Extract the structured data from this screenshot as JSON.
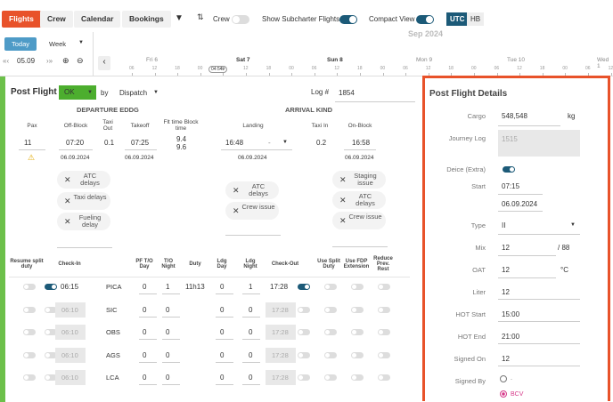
{
  "nav": {
    "tabs": [
      "Flights",
      "Crew",
      "Calendar",
      "Bookings"
    ],
    "crew_label": "Crew",
    "subcharter_label": "Show Subcharter Flights",
    "compact_label": "Compact View",
    "utc": "UTC",
    "hb": "HB"
  },
  "timeline": {
    "month": "Sep 2024",
    "today": "Today",
    "range": "Week",
    "date": "05.09",
    "marker": "04:54z",
    "days": [
      "Fri 6",
      "Sat 7",
      "Sun 8",
      "Mon 9",
      "Tue 10",
      "Wed 1"
    ],
    "hours": [
      "06",
      "12",
      "18",
      "00",
      "06",
      "12",
      "18",
      "00",
      "06",
      "12",
      "18",
      "00",
      "06",
      "12",
      "18",
      "00",
      "06",
      "12",
      "18",
      "00",
      "06",
      "12"
    ]
  },
  "post": {
    "title": "Post Flight",
    "status": "OK",
    "by": "by",
    "dispatch": "Dispatch",
    "log_label": "Log #",
    "log_value": "1854",
    "departure_title": "DEPARTURE EDDG",
    "arrival_title": "ARRIVAL KIND",
    "cols": {
      "pax": "Pax",
      "offblock": "Off-Block",
      "taxiout": "Taxi Out",
      "takeoff": "Takeoff",
      "flttime": "Flt time Block time",
      "landing": "Landing",
      "taxiin": "Taxi In",
      "onblock": "On-Block"
    },
    "values": {
      "pax": "11",
      "offblock": "07:20",
      "taxiout": "0.1",
      "takeoff": "07:25",
      "flt": "9.4",
      "block": "9.6",
      "landing": "16:48",
      "landing_sel": "-",
      "taxiin": "0.2",
      "onblock": "16:58"
    },
    "dates": {
      "offblock": "06.09.2024",
      "takeoff": "06.09.2024",
      "landing": "06.09.2024",
      "onblock": "06.09.2024"
    },
    "dep_delays": [
      "ATC delays",
      "Taxi delays",
      "Fueling delay"
    ],
    "arr_delays": [
      "ATC delays",
      "Crew issue"
    ],
    "staging": [
      "Staging issue",
      "ATC delays",
      "Crew issue"
    ]
  },
  "crew": {
    "headers": {
      "resume": "Resume split duty",
      "checkin": "Check-In",
      "pf": "PF T/O Day",
      "to": "T/O Night",
      "duty": "Duty",
      "ldgday": "Ldg Day",
      "ldgnight": "Ldg Night",
      "checkout": "Check-Out",
      "usesplit": "Use Split Duty",
      "usefdp": "Use FDP Extension",
      "reduce": "Reduce Prev. Rest"
    },
    "rows": [
      {
        "checkin": "06:15",
        "role": "PICA",
        "pf": "0",
        "to": "1",
        "duty": "11h13",
        "ldgday": "0",
        "ldgnight": "1",
        "checkout": "17:28"
      },
      {
        "checkin": "06:10",
        "role": "SIC",
        "pf": "0",
        "to": "0",
        "duty": "",
        "ldgday": "0",
        "ldgnight": "0",
        "checkout": "17:28"
      },
      {
        "checkin": "06:10",
        "role": "OBS",
        "pf": "0",
        "to": "0",
        "duty": "",
        "ldgday": "0",
        "ldgnight": "0",
        "checkout": "17:28"
      },
      {
        "checkin": "06:10",
        "role": "AGS",
        "pf": "0",
        "to": "0",
        "duty": "",
        "ldgday": "0",
        "ldgnight": "0",
        "checkout": "17:28"
      },
      {
        "checkin": "06:10",
        "role": "LCA",
        "pf": "0",
        "to": "0",
        "duty": "",
        "ldgday": "0",
        "ldgnight": "0",
        "checkout": "17:28"
      }
    ]
  },
  "details": {
    "title": "Post Flight Details",
    "cargo_label": "Cargo",
    "cargo": "548,548",
    "cargo_unit": "kg",
    "journey_label": "Journey Log",
    "journey": "1515",
    "deice_label": "Deice (Extra)",
    "start_label": "Start",
    "start_time": "07:15",
    "start_date": "06.09.2024",
    "type_label": "Type",
    "type": "II",
    "mix_label": "Mix",
    "mix": "12",
    "mix_unit": "/ 88",
    "oat_label": "OAT",
    "oat": "12",
    "oat_unit": "°C",
    "liter_label": "Liter",
    "liter": "12",
    "hotstart_label": "HOT Start",
    "hotstart": "15:00",
    "hotend_label": "HOT End",
    "hotend": "21:00",
    "signedon_label": "Signed On",
    "signedon": "12",
    "signedby_label": "Signed By",
    "signedby_opt1": "-",
    "signedby_opt2": "BCV"
  }
}
